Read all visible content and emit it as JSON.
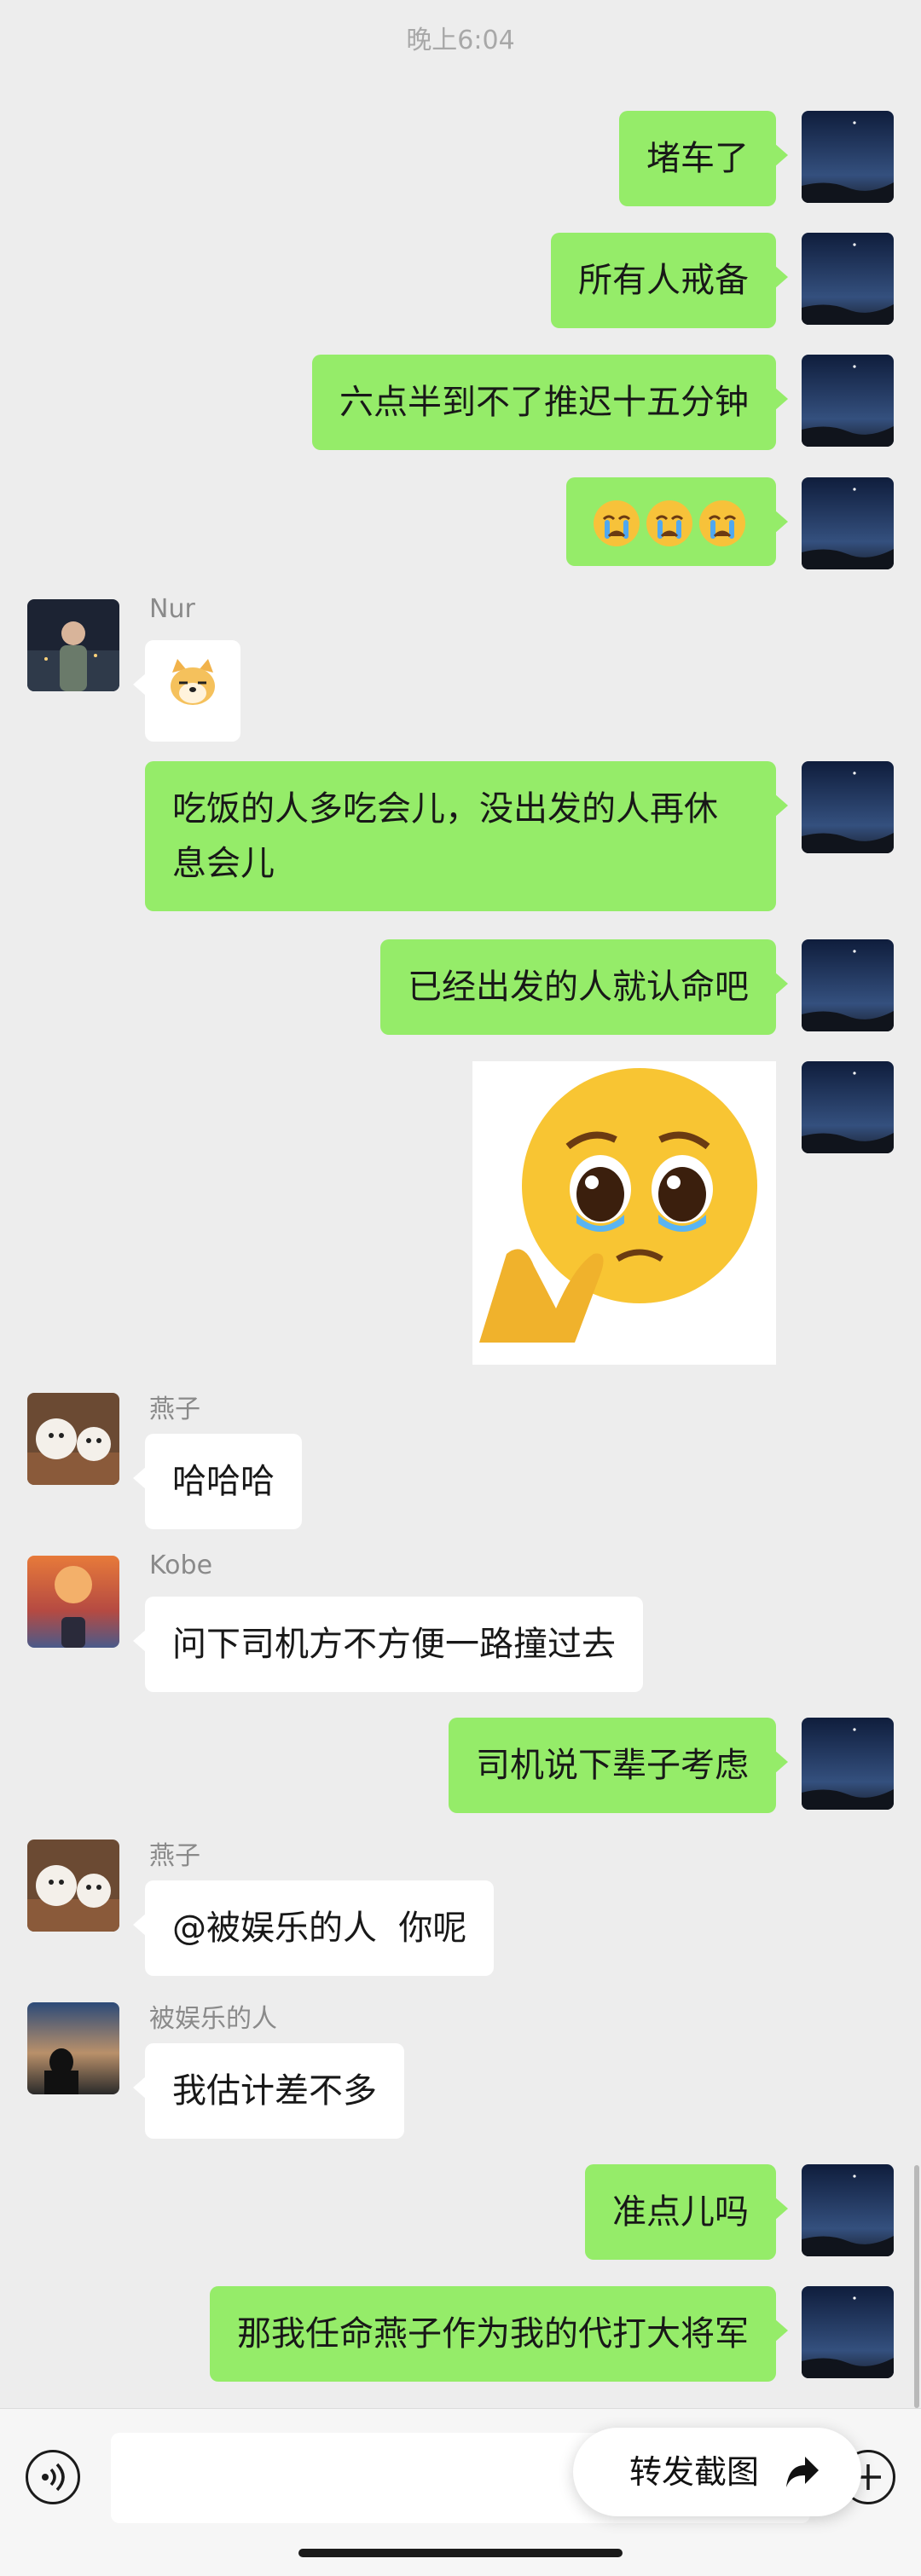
{
  "timestamp": "晚上6:04",
  "messages": [
    {
      "text": "堵车了"
    },
    {
      "text": "所有人戒备"
    },
    {
      "text": "六点半到不了推迟十五分钟"
    },
    {
      "emojis": [
        "crying-face",
        "crying-face",
        "crying-face"
      ]
    },
    {
      "sender": "Nur",
      "sticker": "doge-cat-face"
    },
    {
      "text": "吃饭的人多吃会儿，没出发的人再休息会儿"
    },
    {
      "text": "已经出发的人就认命吧"
    },
    {
      "sticker": "pleading-face-with-heart-hands"
    },
    {
      "sender": "燕子",
      "text": "哈哈哈"
    },
    {
      "sender": "Kobe",
      "text": "问下司机方不方便一路撞过去"
    },
    {
      "text": "司机说下辈子考虑"
    },
    {
      "sender": "燕子",
      "text": "@被娱乐的人  你呢"
    },
    {
      "sender": "被娱乐的人",
      "text": "我估计差不多"
    },
    {
      "text": "准点儿吗"
    },
    {
      "text": "那我任命燕子作为我的代打大将军"
    }
  ],
  "forward_screenshot_label": "转发截图",
  "colors": {
    "background": "#ededed",
    "my_bubble": "#95ec69",
    "other_bubble": "#ffffff"
  }
}
